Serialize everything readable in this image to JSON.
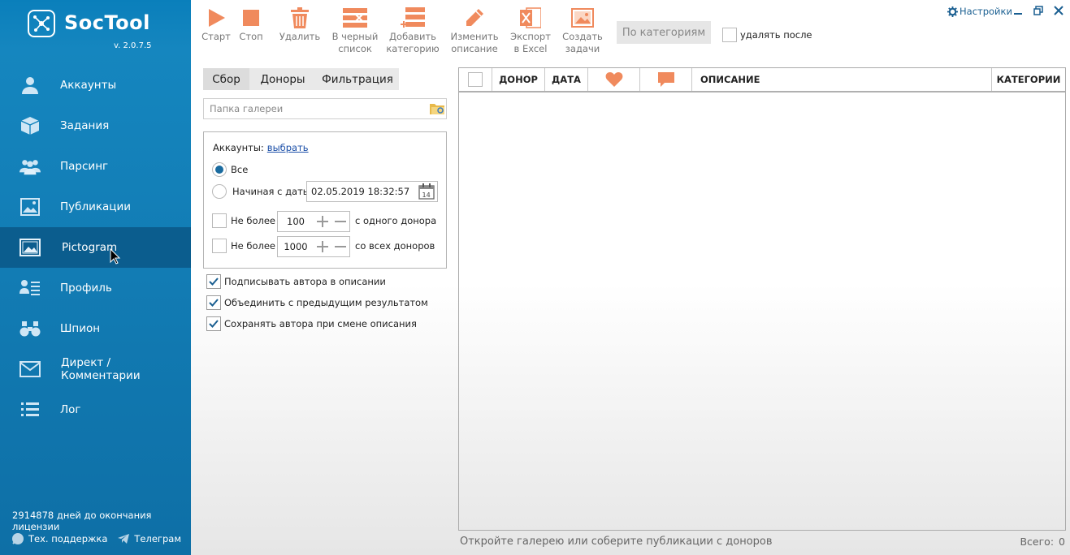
{
  "app": {
    "logo_text": "SocTool",
    "version": "v. 2.0.7.5"
  },
  "sidebar": {
    "items": [
      {
        "label": "Аккаунты",
        "icon": "user-icon"
      },
      {
        "label": "Задания",
        "icon": "box-icon"
      },
      {
        "label": "Парсинг",
        "icon": "users-icon"
      },
      {
        "label": "Публикации",
        "icon": "image-icon"
      },
      {
        "label": "Pictogram",
        "icon": "picture-icon"
      },
      {
        "label": "Профиль",
        "icon": "profile-list-icon"
      },
      {
        "label": "Шпион",
        "icon": "binoculars-icon"
      },
      {
        "label": "Директ / Комментарии",
        "icon": "mail-icon"
      },
      {
        "label": "Лог",
        "icon": "list-icon"
      }
    ],
    "active_index": 4,
    "license_text": "2914878 дней до окончания лицензии",
    "support_label": "Тех. поддержка",
    "telegram_label": "Телеграм"
  },
  "toolbar": {
    "start": "Старт",
    "stop": "Стоп",
    "delete": "Удалить",
    "blacklist_1": "В черный",
    "blacklist_2": "список",
    "add_cat_1": "Добавить",
    "add_cat_2": "категорию",
    "edit_desc_1": "Изменить",
    "edit_desc_2": "описание",
    "export_1": "Экспорт",
    "export_2": "в Excel",
    "create_tasks_1": "Создать",
    "create_tasks_2": "задачи",
    "by_categories": "По категориям",
    "delete_after": "удалять после",
    "settings": "Настройки"
  },
  "tabs": [
    "Сбор",
    "Доноры",
    "Фильтрация"
  ],
  "gallery": {
    "placeholder": "Папка галереи"
  },
  "accounts": {
    "label": "Аккаунты:",
    "link": "выбрать",
    "all": "Все",
    "from_date": "Начиная с даты:",
    "date_value": "02.05.2019 18:32:57",
    "limit_label": "Не более",
    "limit_one_value": "100",
    "limit_one_suffix": "с одного донора",
    "limit_all_value": "1000",
    "limit_all_suffix": "со всех доноров"
  },
  "options": [
    {
      "label": "Подписывать автора в описании",
      "checked": true
    },
    {
      "label": "Объединить с предыдущим результатом",
      "checked": true
    },
    {
      "label": "Сохранять автора при смене описания",
      "checked": true
    }
  ],
  "table": {
    "columns": {
      "donor": "ДОНОР",
      "date": "ДАТА",
      "description": "ОПИСАНИЕ",
      "categories": "КАТЕГОРИИ"
    }
  },
  "status": {
    "message": "Откройте галерею или соберите публикации с доноров",
    "total_label": "Всего:",
    "total_value": "0"
  },
  "colors": {
    "sidebar": "#0a7fbb",
    "sidebar_active": "#0b5d8e",
    "accent": "#f08a5d",
    "link": "#1b4fa8"
  }
}
